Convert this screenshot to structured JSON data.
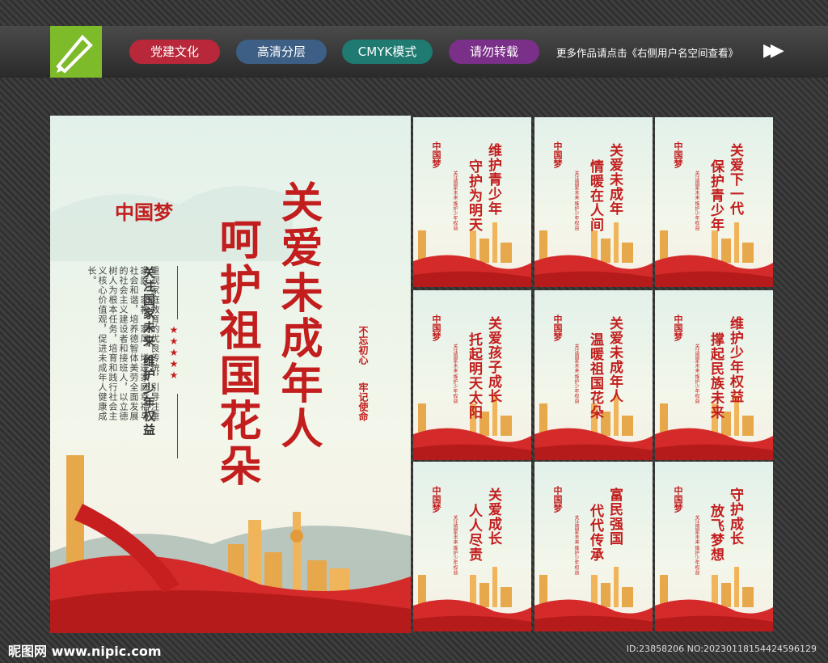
{
  "tags": [
    "党建文化",
    "高清分层",
    "CMYK模式",
    "请勿转载"
  ],
  "note": "更多作品请点击《右侧用户名空间查看》",
  "main": {
    "title_line1": "关爱未成年人",
    "title_line2": "呵护祖国花朵",
    "logo_text": "中国梦",
    "subtitle": "关注国家未来 维护少年权益",
    "body": "重视家庭教育的优良传统，引导注重家庭、家教、家风，增进家庭幸福与社会和谐，培养德智体美劳全面发展的社会主义建设者和接班人，以立德树人为根本任务，培育和践行社会主义核心价值观，促进未成年人健康成长。",
    "side_a": "不忘初心",
    "side_b": "牢记使命"
  },
  "cards": [
    {
      "line1": "维护青少年",
      "line2": "守护为明天"
    },
    {
      "line1": "关爱未成年",
      "line2": "情暖在人间"
    },
    {
      "line1": "关爱下一代",
      "line2": "保护青少年"
    },
    {
      "line1": "关爱孩子成长",
      "line2": "托起明天太阳"
    },
    {
      "line1": "关爱未成年人",
      "line2": "温暖祖国花朵"
    },
    {
      "line1": "维护少年权益",
      "line2": "撑起民族未来"
    },
    {
      "line1": "关爱成长",
      "line2": "人人尽责"
    },
    {
      "line1": "富民强国",
      "line2": "代代传承"
    },
    {
      "line1": "守护成长",
      "line2": "放飞梦想"
    }
  ],
  "card_subtitle": "关注国家未来 维护少年权益",
  "footer_site": "昵图网 www.nipic.com",
  "footer_id": "ID:23858206 NO:20230118154424596129",
  "colors": {
    "accent": "#c21e1e"
  }
}
